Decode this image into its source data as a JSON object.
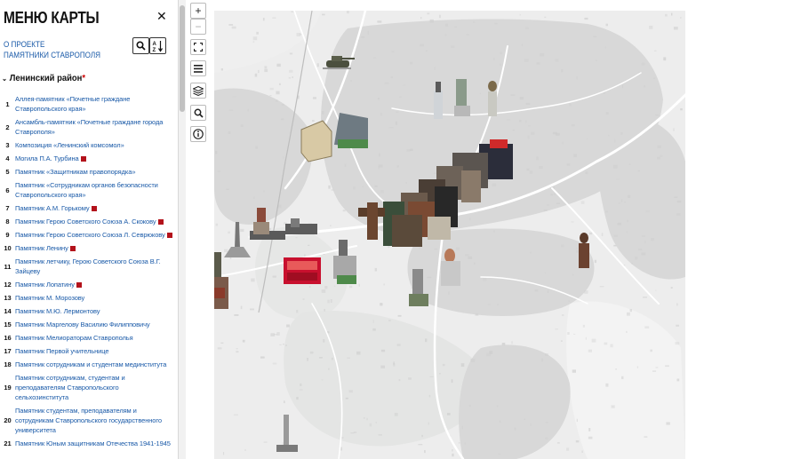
{
  "sidebar": {
    "title": "МЕНЮ КАРТЫ",
    "about_line1": "О ПРОЕКТЕ",
    "about_line2": "ПАМЯТНИКИ СТАВРОПОЛЯ",
    "district": "Ленинский район",
    "district_star": "*",
    "items": [
      {
        "num": "1",
        "text": "Аллея-памятник «Почетные граждане Ставропольского края»",
        "mark": false
      },
      {
        "num": "2",
        "text": "Ансамбль-памятник «Почетные граждане города Ставрополя»",
        "mark": false
      },
      {
        "num": "3",
        "text": "Композиция «Ленинский комсомол»",
        "mark": false
      },
      {
        "num": "4",
        "text": "Могила П.А. Турбина",
        "mark": true
      },
      {
        "num": "5",
        "text": "Памятник «Защитникам правопорядка»",
        "mark": false
      },
      {
        "num": "6",
        "text": "Памятник «Сотрудникам органов безопасности Ставропольского края»",
        "mark": false
      },
      {
        "num": "7",
        "text": "Памятник А.М. Горькому",
        "mark": true
      },
      {
        "num": "8",
        "text": "Памятник Герою Советского Союза А. Скокову",
        "mark": true
      },
      {
        "num": "9",
        "text": "Памятник Герою Советского Союза Л. Севрюкову",
        "mark": true
      },
      {
        "num": "10",
        "text": "Памятник Ленину",
        "mark": true
      },
      {
        "num": "11",
        "text": "Памятник летчику, Герою Советского Союза В.Г. Зайцеву",
        "mark": false
      },
      {
        "num": "12",
        "text": "Памятник Лопатину",
        "mark": true
      },
      {
        "num": "13",
        "text": "Памятник М. Морозову",
        "mark": false
      },
      {
        "num": "14",
        "text": "Памятник М.Ю. Лермонтову",
        "mark": false
      },
      {
        "num": "15",
        "text": "Памятник Маргелову Василию Филипповичу",
        "mark": false
      },
      {
        "num": "16",
        "text": "Памятник Мелиораторам Ставрополья",
        "mark": false
      },
      {
        "num": "17",
        "text": "Памятник Первой учительнице",
        "mark": false
      },
      {
        "num": "18",
        "text": "Памятник сотрудникам и студентам мединститута",
        "mark": false
      },
      {
        "num": "19",
        "text": "Памятник сотрудникам, студентам и преподавателям Ставропольского сельхозинститута",
        "mark": false
      },
      {
        "num": "20",
        "text": "Памятник студентам, преподавателям и сотрудникам Ставропольского государственного университета",
        "mark": false
      },
      {
        "num": "21",
        "text": "Памятник Юным защитникам Отечества 1941-1945",
        "mark": false
      }
    ]
  },
  "map_controls": {
    "zoom_in": "+",
    "zoom_out": "−",
    "fullscreen": "fullscreen-icon",
    "menu": "menu-icon",
    "layers": "layers-icon",
    "search": "search-icon",
    "info": "info-icon"
  },
  "map": {
    "base": "#ededed",
    "roads": "#ffffff",
    "blocks": "#d9d9d9",
    "green": "#e3e5e3",
    "monument_card": "#c8102e"
  }
}
